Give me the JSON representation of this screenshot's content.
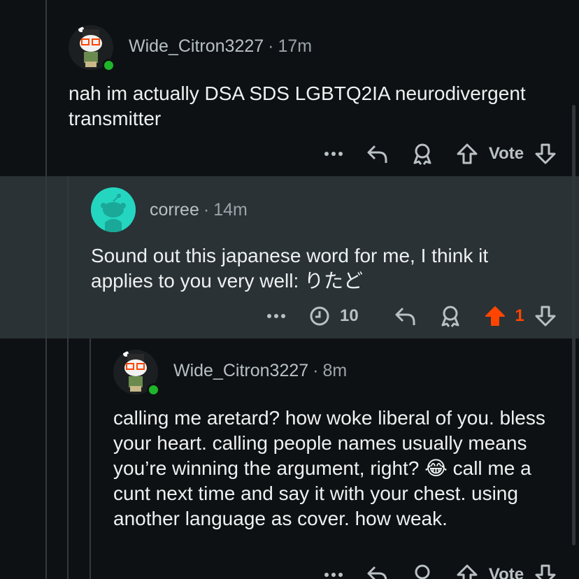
{
  "comments": [
    {
      "username": "Wide_Citron3227",
      "age": "17m",
      "body": "nah im actually DSA SDS LGBTQ2IA neurodivergent transmitter",
      "actions": {
        "vote_label": "Vote"
      }
    },
    {
      "username": "corree",
      "age": "14m",
      "body": "Sound out this japanese word for me, I think it applies to you very well: りたど",
      "actions": {
        "award_count": "10",
        "score": "1"
      }
    },
    {
      "username": "Wide_Citron3227",
      "age": "8m",
      "body": "calling me aretard? how woke liberal of you. bless your heart. calling people names usually means you’re winning the argument, right? 😂 call me a cunt next time and say it with your chest. using another language as cover. how weak.",
      "actions": {
        "vote_label": "Vote"
      }
    }
  ],
  "colors": {
    "background": "#0e1113",
    "highlight": "#2a3235",
    "upvoted": "#ff4500",
    "online": "#1fb52a",
    "avatar_teal": "#24d6c0"
  },
  "icons": [
    "more-icon",
    "reply-icon",
    "award-icon",
    "upvote-icon",
    "downvote-icon",
    "clock-icon"
  ]
}
